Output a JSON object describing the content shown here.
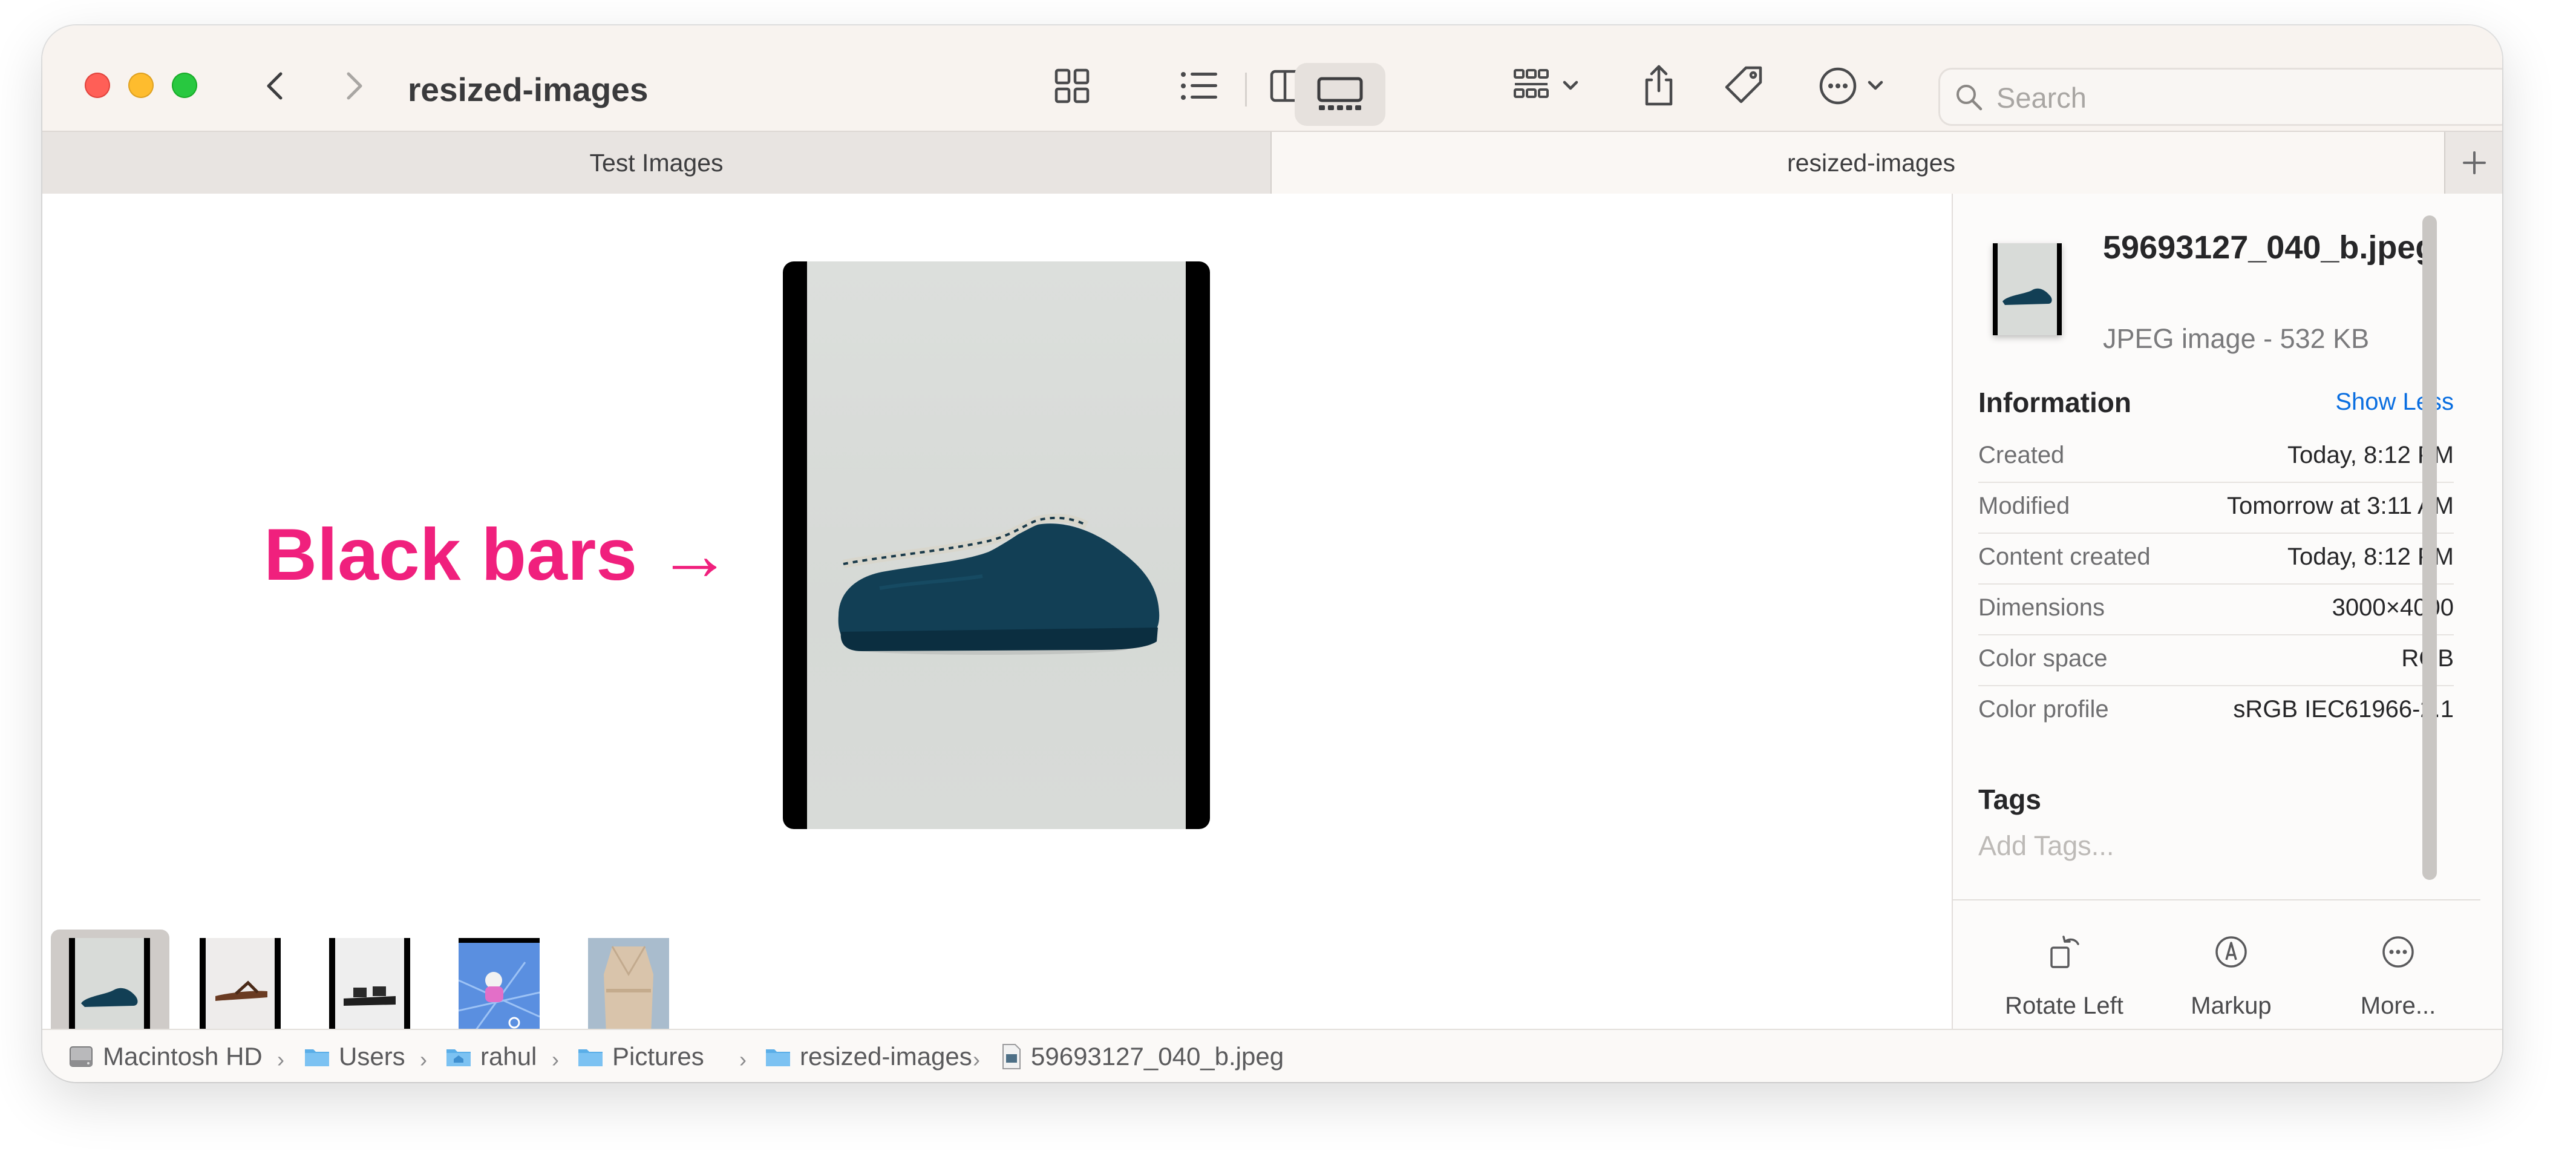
{
  "window": {
    "title": "resized-images"
  },
  "search": {
    "placeholder": "Search"
  },
  "tabs": [
    {
      "label": "Test Images",
      "active": false
    },
    {
      "label": "resized-images",
      "active": true
    }
  ],
  "gallery": {
    "annotation": "Black bars →",
    "annotation_color": "#f0207d",
    "selected_index": 0,
    "thumbnails": [
      {
        "subject": "teal-slipper"
      },
      {
        "subject": "brown-flip-flop"
      },
      {
        "subject": "black-sandal"
      },
      {
        "subject": "toy-figure-on-blue"
      },
      {
        "subject": "beige-coat"
      }
    ]
  },
  "inspector": {
    "file_name": "59693127_040_b.jpeg",
    "kind": "JPEG image - 532 KB",
    "info_heading": "Information",
    "show_less": "Show Less",
    "rows": [
      {
        "key": "Created",
        "value": "Today, 8:12 PM"
      },
      {
        "key": "Modified",
        "value": "Tomorrow at 3:11 AM"
      },
      {
        "key": "Content created",
        "value": "Today, 8:12 PM"
      },
      {
        "key": "Dimensions",
        "value": "3000×4000"
      },
      {
        "key": "Color space",
        "value": "RGB"
      },
      {
        "key": "Color profile",
        "value": "sRGB IEC61966-2.1"
      }
    ],
    "tags_heading": "Tags",
    "tags_placeholder": "Add Tags...",
    "actions": [
      {
        "label": "Rotate Left",
        "icon": "rotate-left-icon"
      },
      {
        "label": "Markup",
        "icon": "markup-icon"
      },
      {
        "label": "More...",
        "icon": "more-icon"
      }
    ]
  },
  "path": [
    {
      "label": "Macintosh HD",
      "icon": "hard-drive-icon"
    },
    {
      "label": "Users",
      "icon": "folder-icon"
    },
    {
      "label": "rahul",
      "icon": "home-folder-icon"
    },
    {
      "label": "Pictures",
      "icon": "folder-icon"
    },
    {
      "label": "resized-images",
      "icon": "folder-icon"
    },
    {
      "label": "59693127_040_b.jpeg",
      "icon": "jpeg-file-icon"
    }
  ],
  "colors": {
    "accent_link": "#0a6ee0",
    "close": "#ff5f57",
    "minimize": "#febc2e",
    "zoom": "#28c840",
    "folder": "#5aaee8"
  }
}
